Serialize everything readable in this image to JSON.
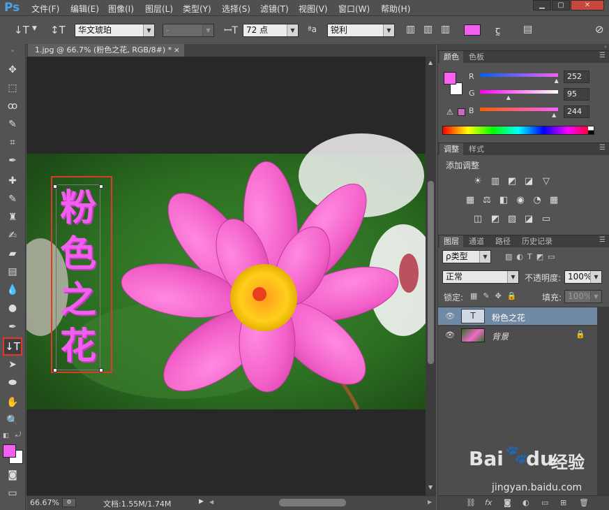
{
  "app": {
    "logo": "Ps",
    "window_buttons": [
      "▁",
      "▢",
      "✕"
    ]
  },
  "menu": [
    "文件(F)",
    "编辑(E)",
    "图像(I)",
    "图层(L)",
    "类型(Y)",
    "选择(S)",
    "滤镜(T)",
    "视图(V)",
    "窗口(W)",
    "帮助(H)"
  ],
  "options": {
    "font_family": "华文琥珀",
    "font_style": "-",
    "font_size": "72 点",
    "aa_label": "ªa",
    "antialias": "锐利",
    "text_color": "#f25ff0"
  },
  "document": {
    "tab_title": "1.jpg @ 66.7% (粉色之花, RGB/8#) *",
    "close": "×",
    "text_chars": [
      "粉",
      "色",
      "之",
      "花"
    ],
    "text_color": "#f25ff0"
  },
  "status": {
    "zoom": "66.67%",
    "doc_size": "文档:1.55M/1.74M"
  },
  "color_panel": {
    "tabs": [
      "颜色",
      "色板"
    ],
    "channels": [
      {
        "label": "R",
        "value": "252",
        "fraction": 0.988
      },
      {
        "label": "G",
        "value": "95",
        "fraction": 0.373
      },
      {
        "label": "B",
        "value": "244",
        "fraction": 0.957
      }
    ],
    "foreground": "#fc5ff4",
    "background": "#ffffff"
  },
  "adjustments_panel": {
    "tabs": [
      "调整",
      "样式"
    ],
    "title": "添加调整",
    "row1": [
      "☀",
      "▥",
      "◩",
      "◪",
      "▽"
    ],
    "row2": [
      "▦",
      "⚖",
      "◧",
      "◉",
      "◔",
      "▦"
    ],
    "row3": [
      "◫",
      "◩",
      "▨",
      "◪",
      "▭"
    ]
  },
  "layers_panel": {
    "tabs": [
      "图层",
      "通道",
      "路径",
      "历史记录"
    ],
    "filter": "ρ类型",
    "blend_mode": "正常",
    "opacity_label": "不透明度:",
    "opacity": "100%",
    "lock_label": "锁定:",
    "fill_label": "填充:",
    "fill": "100%",
    "layers": [
      {
        "name": "粉色之花",
        "thumb": "T",
        "selected": true
      },
      {
        "name": "背景",
        "locked": true,
        "selected": false
      }
    ],
    "footer_icons": [
      "⛓",
      "fx",
      "◙",
      "◐",
      "▭",
      "⊞",
      "🗑"
    ]
  },
  "watermark": {
    "brand": "Bai",
    "brand2": "du",
    "cn": "经验",
    "url": "jingyan.baidu.com"
  }
}
